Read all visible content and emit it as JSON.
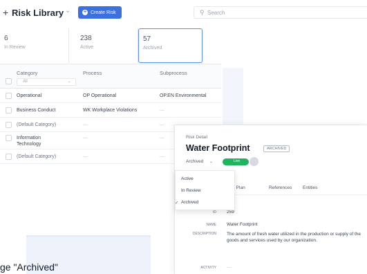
{
  "header": {
    "title": "Risk Library",
    "create_label": "Create Risk",
    "search_placeholder": "Search"
  },
  "stats": [
    {
      "count": "6",
      "label": "In Review"
    },
    {
      "count": "238",
      "label": "Active"
    },
    {
      "count": "57",
      "label": "Archived"
    }
  ],
  "table": {
    "columns": [
      "Category",
      "Process",
      "Subprocess"
    ],
    "filter_value": "All",
    "rows": [
      {
        "category": "Operational",
        "process": "OP Operational",
        "subprocess": "OP.EN Environmental"
      },
      {
        "category": "Business Conduct",
        "process": "WK Workplace Violations",
        "subprocess": "—"
      },
      {
        "category": "(Default Category)",
        "process": "—",
        "subprocess": "—"
      },
      {
        "category": "Information Technology",
        "process": "—",
        "subprocess": "—"
      },
      {
        "category": "(Default Category)",
        "process": "—",
        "subprocess": "—"
      }
    ]
  },
  "detail": {
    "subtitle": "Risk Detail",
    "title": "Water Footprint",
    "badge": "ARCHIVED",
    "status_value": "Archived",
    "toggle_label": "Live",
    "tabs": [
      "k Mitigation Plan",
      "References",
      "Entities"
    ],
    "dropdown_options": [
      "Active",
      "In Review",
      "Archived"
    ],
    "selected_option": "Archived",
    "fields": {
      "id_label": "ID",
      "id_value": "259",
      "name_label": "Name",
      "name_value": "Water Footprint",
      "description_label": "Description",
      "description_value": "The amount of fresh water utilized in the production or supply of the goods and services used by our organization.",
      "activity_label": "Activity",
      "activity_value": "—"
    }
  },
  "caption": "ge \"Archived\"",
  "colors": {
    "accent": "#3c6fe0",
    "live": "#22b35e",
    "selected_border": "#5b8dee"
  }
}
